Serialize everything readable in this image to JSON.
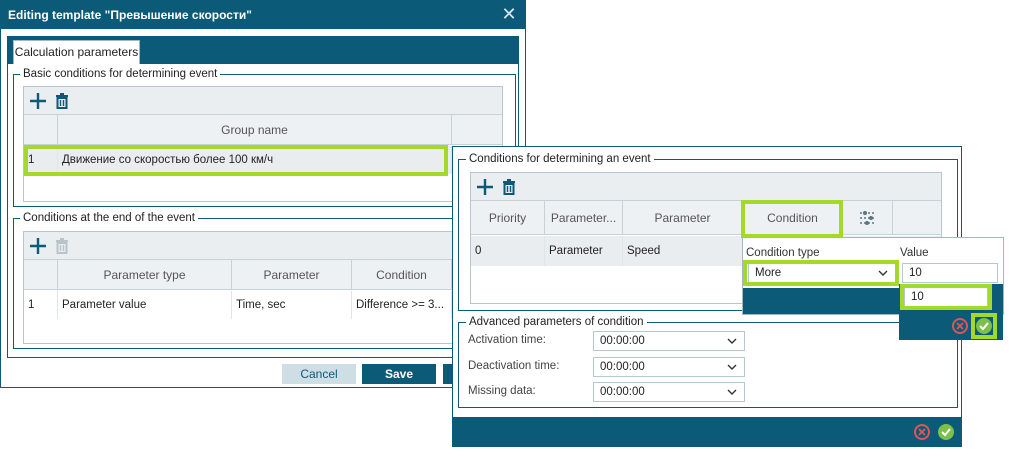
{
  "main_dialog": {
    "title": "Editing template \"Превышение скорости\"",
    "tab_label": "Calculation parameters",
    "basic_group": {
      "legend": "Basic conditions for determining event",
      "column_header": "Group name",
      "row": {
        "index": "1",
        "name": "Движение со скоростью более 100 км/ч"
      }
    },
    "end_group": {
      "legend": "Conditions at the end of the event",
      "columns": [
        "Parameter type",
        "Parameter",
        "Condition"
      ],
      "row": {
        "index": "1",
        "type": "Parameter value",
        "parameter": "Time, sec",
        "condition": "Difference >= 3..."
      }
    },
    "buttons": {
      "cancel": "Cancel",
      "save": "Save"
    }
  },
  "conditions_dialog": {
    "group_legend": "Conditions for determining an event",
    "columns": [
      "Priority",
      "Parameter...",
      "Parameter",
      "Condition"
    ],
    "row": {
      "priority": "0",
      "param_type": "Parameter",
      "param": "Speed"
    },
    "advanced": {
      "legend": "Advanced parameters of condition",
      "fields": [
        {
          "label": "Activation time:",
          "value": "00:00:00"
        },
        {
          "label": "Deactivation time:",
          "value": "00:00:00"
        },
        {
          "label": "Missing data:",
          "value": "00:00:00"
        }
      ]
    }
  },
  "condition_popup": {
    "type_label": "Condition type",
    "value_label": "Value",
    "type_value": "More",
    "value_input": "10",
    "suggestion": "10"
  },
  "colors": {
    "primary": "#0b5a78",
    "highlight": "#a4d82a",
    "accept": "#7cc04b",
    "reject": "#e05555"
  }
}
